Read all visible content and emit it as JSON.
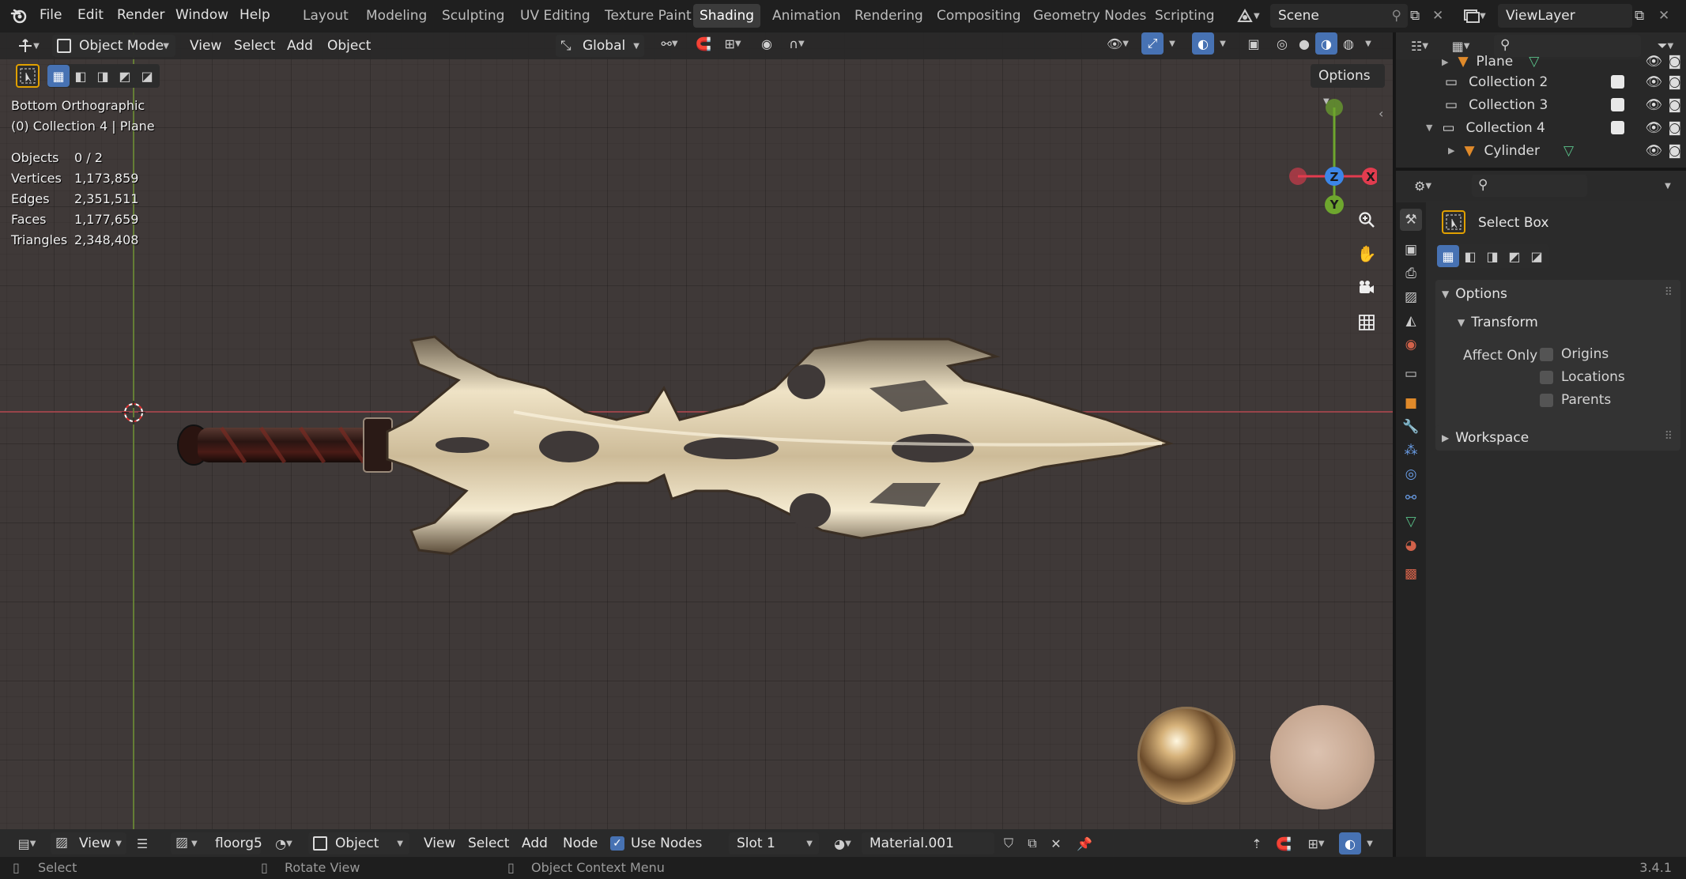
{
  "topbar": {
    "menus": [
      "File",
      "Edit",
      "Render",
      "Window",
      "Help"
    ],
    "workspaces": [
      "Layout",
      "Modeling",
      "Sculpting",
      "UV Editing",
      "Texture Paint",
      "Shading",
      "Animation",
      "Rendering",
      "Compositing",
      "Geometry Nodes",
      "Scripting"
    ],
    "active_workspace": "Shading",
    "scene": "Scene",
    "view_layer": "ViewLayer"
  },
  "viewport_header": {
    "mode": "Object Mode",
    "menus": [
      "View",
      "Select",
      "Add",
      "Object"
    ],
    "orientation": "Global",
    "options_label": "Options"
  },
  "viewport_overlay": {
    "view_name": "Bottom Orthographic",
    "collection_info": "(0) Collection 4 | Plane",
    "stats": [
      {
        "label": "Objects",
        "value": "0 / 2"
      },
      {
        "label": "Vertices",
        "value": "1,173,859"
      },
      {
        "label": "Edges",
        "value": "2,351,511"
      },
      {
        "label": "Faces",
        "value": "1,177,659"
      },
      {
        "label": "Triangles",
        "value": "2,348,408"
      }
    ]
  },
  "gizmo": {
    "x": "X",
    "y": "Y",
    "z": "Z"
  },
  "shader_header": {
    "view": "View",
    "image_name": "floorg5",
    "object_type": "Object",
    "menus": [
      "View",
      "Select",
      "Add",
      "Node"
    ],
    "use_nodes_label": "Use Nodes",
    "use_nodes": true,
    "slot": "Slot 1",
    "material": "Material.001"
  },
  "statusbar": {
    "select": "Select",
    "rotate": "Rotate View",
    "context": "Object Context Menu",
    "version": "3.4.1"
  },
  "outliner": {
    "rows": [
      {
        "name": "Plane",
        "type": "mesh",
        "indent": 2
      },
      {
        "name": "Collection 2",
        "type": "collection",
        "indent": 1
      },
      {
        "name": "Collection 3",
        "type": "collection",
        "indent": 1
      },
      {
        "name": "Collection 4",
        "type": "collection",
        "indent": 1
      },
      {
        "name": "Cylinder",
        "type": "mesh",
        "indent": 2
      }
    ]
  },
  "properties": {
    "tool_name": "Select Box",
    "options_label": "Options",
    "transform_label": "Transform",
    "affect_only_label": "Affect Only",
    "affect_only": [
      {
        "label": "Origins",
        "checked": false
      },
      {
        "label": "Locations",
        "checked": false
      },
      {
        "label": "Parents",
        "checked": false
      }
    ],
    "workspace_label": "Workspace"
  },
  "colors": {
    "accent": "#4772b3",
    "x_axis": "#e23c4f",
    "y_axis": "#6ea62e",
    "z_axis": "#3c86e8"
  }
}
